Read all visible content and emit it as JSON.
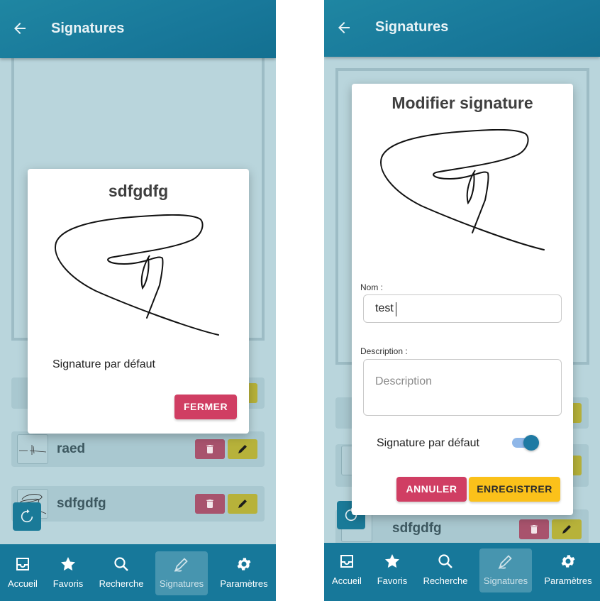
{
  "screens": [
    {
      "header": {
        "title": "Signatures"
      },
      "list": [
        {
          "name": "raed"
        },
        {
          "name": "sdfgdfg"
        }
      ],
      "modal": {
        "title": "sdfgdfg",
        "default_label": "Signature par défaut",
        "close_button": "FERMER"
      }
    },
    {
      "header": {
        "title": "Signatures"
      },
      "list": [
        {
          "name": "sdfgdfg"
        }
      ],
      "modal": {
        "title": "Modifier signature",
        "name_label": "Nom :",
        "name_value": "test",
        "description_label": "Description :",
        "description_placeholder": "Description",
        "default_label": "Signature par défaut",
        "default_on": true,
        "cancel_button": "ANNULER",
        "save_button": "ENREGISTRER"
      }
    }
  ],
  "nav": [
    {
      "label": "Accueil",
      "icon": "inbox-icon"
    },
    {
      "label": "Favoris",
      "icon": "star-icon"
    },
    {
      "label": "Recherche",
      "icon": "search-icon"
    },
    {
      "label": "Signatures",
      "icon": "pen-icon",
      "active": true
    },
    {
      "label": "Paramètres",
      "icon": "gear-icon"
    }
  ],
  "colors": {
    "appbar": "#18789a",
    "background_dimmed": "#b9d5dc",
    "button_pink": "#d03e63",
    "button_yellow": "#fbc11a",
    "toggle": "#1f7aa3"
  }
}
